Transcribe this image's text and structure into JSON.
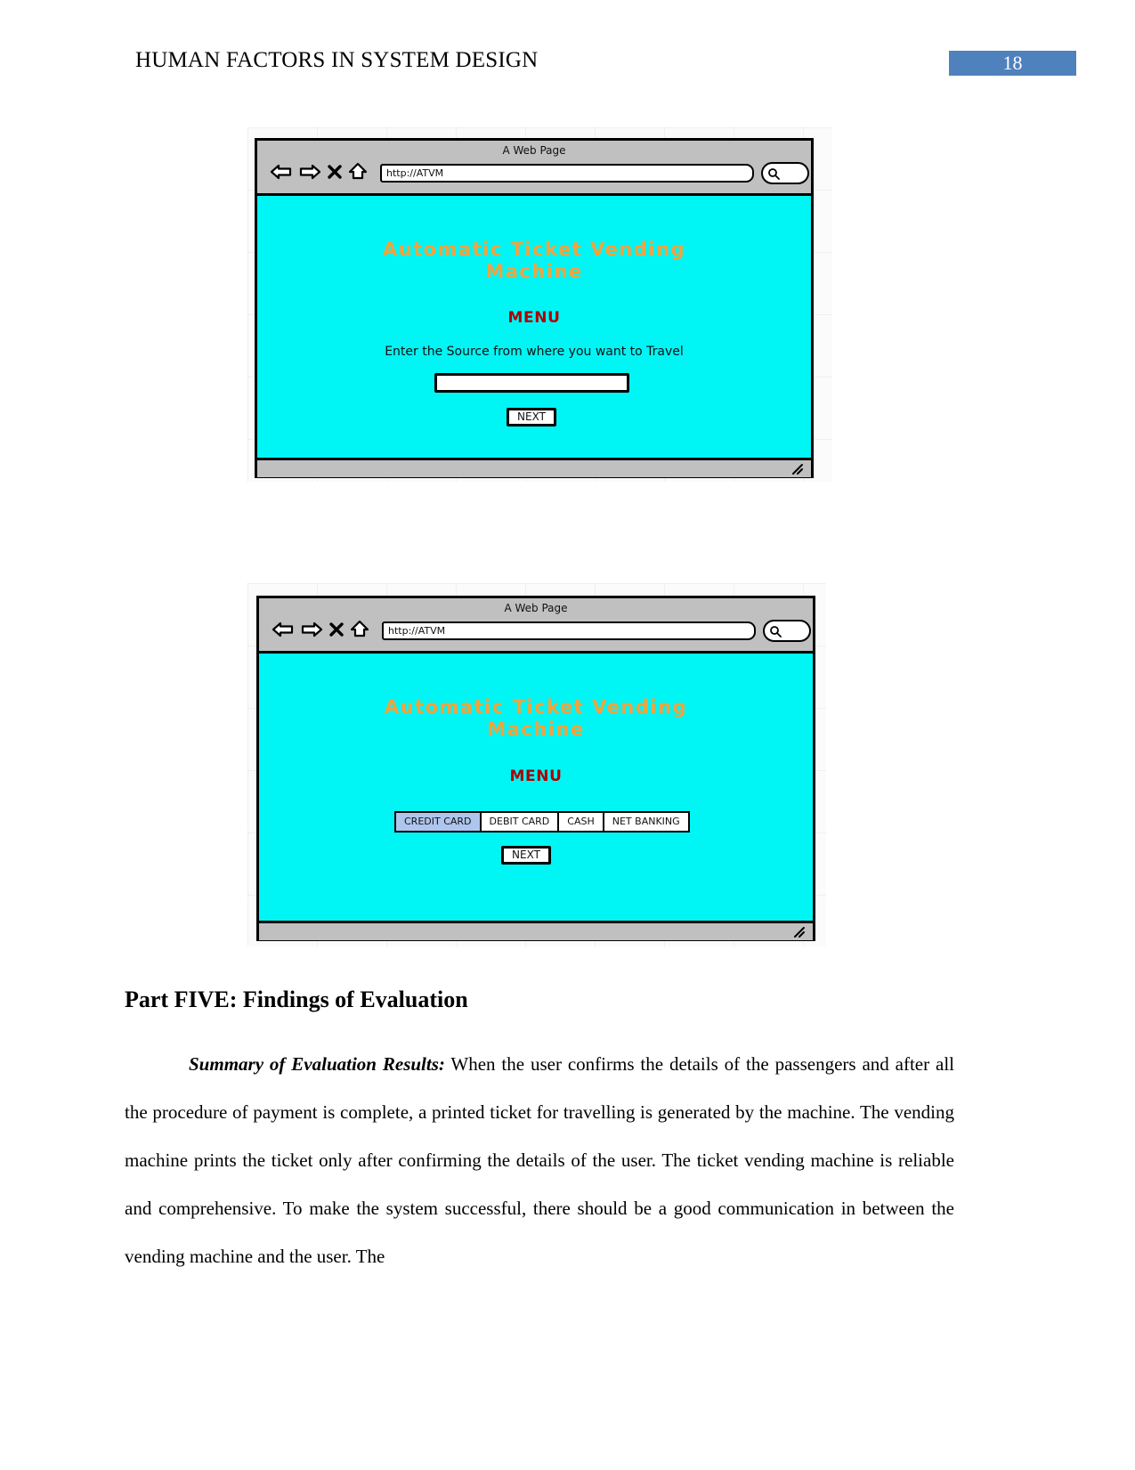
{
  "header": {
    "running_title": "HUMAN FACTORS IN SYSTEM DESIGN",
    "page_number": "18",
    "page_number_bg": "#4f81bd"
  },
  "colors": {
    "screen_bg": "#00f5f5",
    "title_orange": "#f2a33c",
    "menu_red": "#b00000",
    "chrome_gray": "#c0c0c0",
    "tab_selected": "#aec6ee"
  },
  "mockups": [
    {
      "id": "source-entry-screen",
      "caption": "A Web Page",
      "url": "http://ATVM",
      "title": "Automatic Ticket Vending Machine",
      "menu_label": "MENU",
      "prompt": "Enter the Source from where you want to Travel",
      "input_value": "",
      "next_label": "NEXT",
      "icons": [
        "back-arrow-icon",
        "forward-arrow-icon",
        "close-x-icon",
        "home-icon",
        "search-magnifier-icon",
        "resize-grip-icon"
      ]
    },
    {
      "id": "payment-method-screen",
      "caption": "A Web Page",
      "url": "http://ATVM",
      "title": "Automatic Ticket Vending Machine",
      "menu_label": "MENU",
      "tabs": [
        {
          "label": "CREDIT CARD",
          "selected": true
        },
        {
          "label": "DEBIT CARD",
          "selected": false
        },
        {
          "label": "CASH",
          "selected": false
        },
        {
          "label": "NET BANKING",
          "selected": false
        }
      ],
      "next_label": "NEXT",
      "icons": [
        "back-arrow-icon",
        "forward-arrow-icon",
        "close-x-icon",
        "home-icon",
        "search-magnifier-icon",
        "resize-grip-icon"
      ]
    }
  ],
  "document": {
    "section_heading": "Part FIVE: Findings of Evaluation",
    "paragraph_lead": "Summary of Evaluation Results:",
    "paragraph_text": " When the user confirms the details of the passengers and after all the procedure of payment is complete, a printed ticket for travelling is generated by the machine. The vending machine prints the ticket only after confirming the details of the user. The ticket vending machine is reliable and comprehensive. To make the system successful, there should be a good communication in between the vending machine and the user. The"
  }
}
